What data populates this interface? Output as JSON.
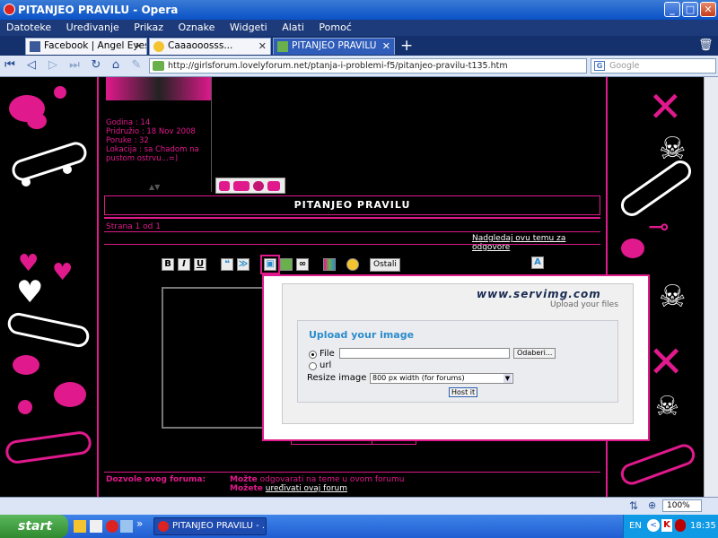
{
  "window": {
    "title": "PITANJEO PRAVILU - Opera",
    "buttons": {
      "minimize": "_",
      "maximize": "□",
      "close": "✕"
    }
  },
  "menu": [
    "Datoteke",
    "Uređivanje",
    "Prikaz",
    "Oznake",
    "Widgeti",
    "Alati",
    "Pomoć"
  ],
  "tabs": [
    {
      "label": "Facebook | Angel Eyes",
      "close": "✕"
    },
    {
      "label": "Caaaooosss...",
      "close": "✕"
    },
    {
      "label": "PITANJEO PRAVILU",
      "close": "✕",
      "active": true
    }
  ],
  "tabbar": {
    "new_tab": "+",
    "trash": "🗑"
  },
  "nav": {
    "address": "http://girlsforum.lovelyforum.net/ptanja-i-problemi-f5/pitanjeo-pravilu-t135.htm",
    "search_placeholder": "Google"
  },
  "profile": {
    "age": "Godina : 14",
    "joined": "Pridružio : 18 Nov 2008",
    "posts": "Poruke : 32",
    "location_line1": "Lokacija : sa Chadom na",
    "location_line2": "pustom ostrvu...=)"
  },
  "topic": {
    "title": "PITANJEO PRAVILU",
    "page": "Strana 1 od 1",
    "watch": "Nadgledaj ovu temu za odgovore"
  },
  "editor": {
    "bold": "B",
    "italic": "I",
    "underline": "U",
    "others": "Ostali"
  },
  "upload": {
    "brand": "www.servimg.com",
    "tagline": "Upload your files",
    "heading": "Upload your image",
    "file_label": "File",
    "browse": "Odaberi...",
    "url_label": "url",
    "resize_label": "Resize image",
    "resize_value": "800 px width (for forums)",
    "host_button": "Host it"
  },
  "permissions": {
    "heading": "Dozvole ovog foruma:",
    "line1_prefix": "Možte",
    "line1_text": "odgovarati na teme u ovom forumu",
    "line2_prefix": "Možete",
    "line2_link": "uređivati ovaj forum"
  },
  "statusbar": {
    "zoom": "100%"
  },
  "taskbar": {
    "start": "start",
    "window": "PITANJEO PRAVILU - ...",
    "lang": "EN",
    "time": "18:35",
    "overflow": "»"
  },
  "colors": {
    "accent_pink": "#e0198c",
    "link_blue": "#2a8ccd"
  }
}
